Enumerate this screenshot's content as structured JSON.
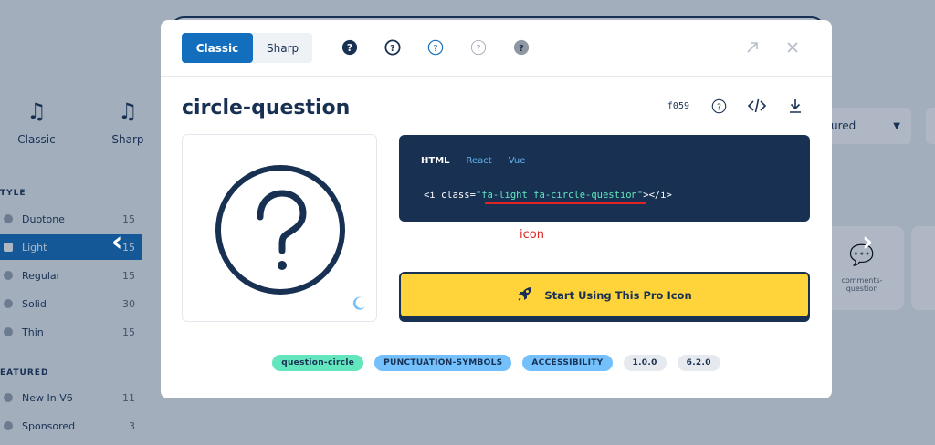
{
  "background": {
    "categories": [
      {
        "label": "Classic",
        "icon": "music-heart-icon"
      },
      {
        "label": "Sharp",
        "icon": "music-heart-sharp-icon"
      }
    ],
    "style_heading": "TYLE",
    "style_items": [
      {
        "label": "Duotone",
        "count": "15"
      },
      {
        "label": "Light",
        "count": "15"
      },
      {
        "label": "Regular",
        "count": "15"
      },
      {
        "label": "Solid",
        "count": "30"
      },
      {
        "label": "Thin",
        "count": "15"
      }
    ],
    "featured_heading": "EATURED",
    "featured_items": [
      {
        "label": "New In V6",
        "count": "11"
      },
      {
        "label": "Sponsored",
        "count": "3"
      }
    ],
    "sort_label": "ured",
    "side_card_label": "comments-\nquestion"
  },
  "modal": {
    "family_toggle": {
      "classic": "Classic",
      "sharp": "Sharp"
    },
    "style_icons": [
      "circle-question-solid-icon",
      "circle-question-regular-icon",
      "circle-question-light-icon",
      "circle-question-thin-icon",
      "circle-question-duotone-icon"
    ],
    "title": "circle-question",
    "unicode": "f059",
    "code_tabs": {
      "html": "HTML",
      "react": "React",
      "vue": "Vue"
    },
    "code": {
      "open": "<i class=",
      "quote_open": "\"",
      "class_value": "fa-light fa-circle-question",
      "quote_close": "\"",
      "close": "></i>"
    },
    "annotation": "icon",
    "pro_button_label": "Start Using This Pro Icon",
    "tags": [
      {
        "label": "question-circle",
        "kind": "green"
      },
      {
        "label": "PUNCTUATION-SYMBOLS",
        "kind": "blue"
      },
      {
        "label": "ACCESSIBILITY",
        "kind": "blue"
      },
      {
        "label": "1.0.0",
        "kind": "gray"
      },
      {
        "label": "6.2.0",
        "kind": "gray"
      }
    ]
  },
  "colors": {
    "navy": "#183153",
    "blue": "#146ebe",
    "yellow": "#ffd43b",
    "mint": "#63e6be",
    "sky": "#74c0fc",
    "red": "#e02424"
  }
}
